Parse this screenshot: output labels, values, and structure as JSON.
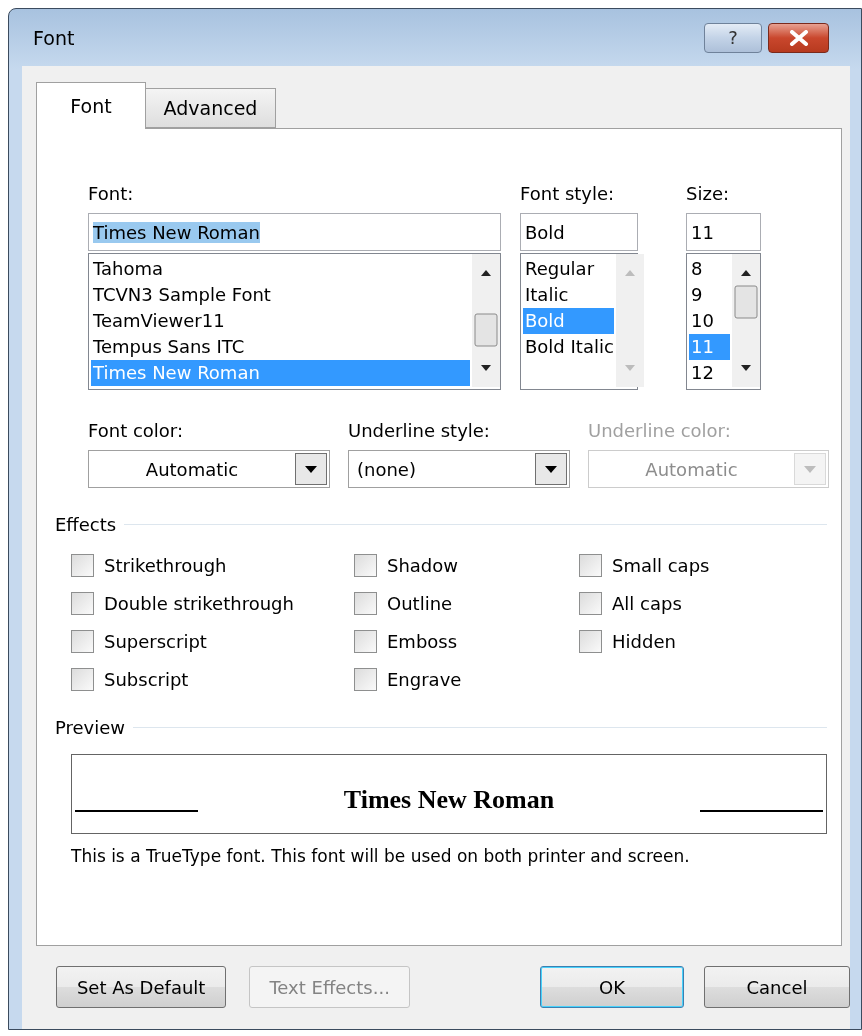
{
  "window": {
    "title": "Font",
    "help_label": "?"
  },
  "tabs": [
    {
      "label": "Font",
      "selected": true
    },
    {
      "label": "Advanced",
      "selected": false
    }
  ],
  "font": {
    "label": "Font:",
    "value": "Times New Roman",
    "value_highlighted": true,
    "items": [
      {
        "label": "Tahoma",
        "selected": false
      },
      {
        "label": "TCVN3 Sample Font",
        "selected": false
      },
      {
        "label": "TeamViewer11",
        "selected": false
      },
      {
        "label": "Tempus Sans ITC",
        "selected": false
      },
      {
        "label": "Times New Roman",
        "selected": true
      }
    ]
  },
  "font_style": {
    "label": "Font style:",
    "value": "Bold",
    "items": [
      {
        "label": "Regular",
        "selected": false
      },
      {
        "label": "Italic",
        "selected": false
      },
      {
        "label": "Bold",
        "selected": true
      },
      {
        "label": "Bold Italic",
        "selected": false
      }
    ]
  },
  "size": {
    "label": "Size:",
    "value": "11",
    "items": [
      {
        "label": "8",
        "selected": false
      },
      {
        "label": "9",
        "selected": false
      },
      {
        "label": "10",
        "selected": false
      },
      {
        "label": "11",
        "selected": true
      },
      {
        "label": "12",
        "selected": false
      }
    ]
  },
  "dropdowns": [
    {
      "label": "Font color:",
      "value": "Automatic",
      "disabled": false
    },
    {
      "label": "Underline style:",
      "value": "(none)",
      "disabled": false
    },
    {
      "label": "Underline color:",
      "value": "Automatic",
      "disabled": true
    }
  ],
  "effects": {
    "title": "Effects",
    "columns": [
      [
        {
          "label": "Strikethrough",
          "checked": false
        },
        {
          "label": "Double strikethrough",
          "checked": false
        },
        {
          "label": "Superscript",
          "checked": false
        },
        {
          "label": "Subscript",
          "checked": false
        }
      ],
      [
        {
          "label": "Shadow",
          "checked": false
        },
        {
          "label": "Outline",
          "checked": false
        },
        {
          "label": "Emboss",
          "checked": false
        },
        {
          "label": "Engrave",
          "checked": false
        }
      ],
      [
        {
          "label": "Small caps",
          "checked": false
        },
        {
          "label": "All caps",
          "checked": false
        },
        {
          "label": "Hidden",
          "checked": false
        }
      ]
    ]
  },
  "preview": {
    "title": "Preview",
    "sample": "Times New Roman",
    "note": "This is a TrueType font. This font will be used on both printer and screen."
  },
  "buttons": [
    {
      "label": "Set As Default",
      "disabled": false,
      "default": false
    },
    {
      "label": "Text Effects...",
      "disabled": true,
      "default": false
    },
    {
      "label": "OK",
      "disabled": false,
      "default": true
    },
    {
      "label": "Cancel",
      "disabled": false,
      "default": false
    }
  ]
}
